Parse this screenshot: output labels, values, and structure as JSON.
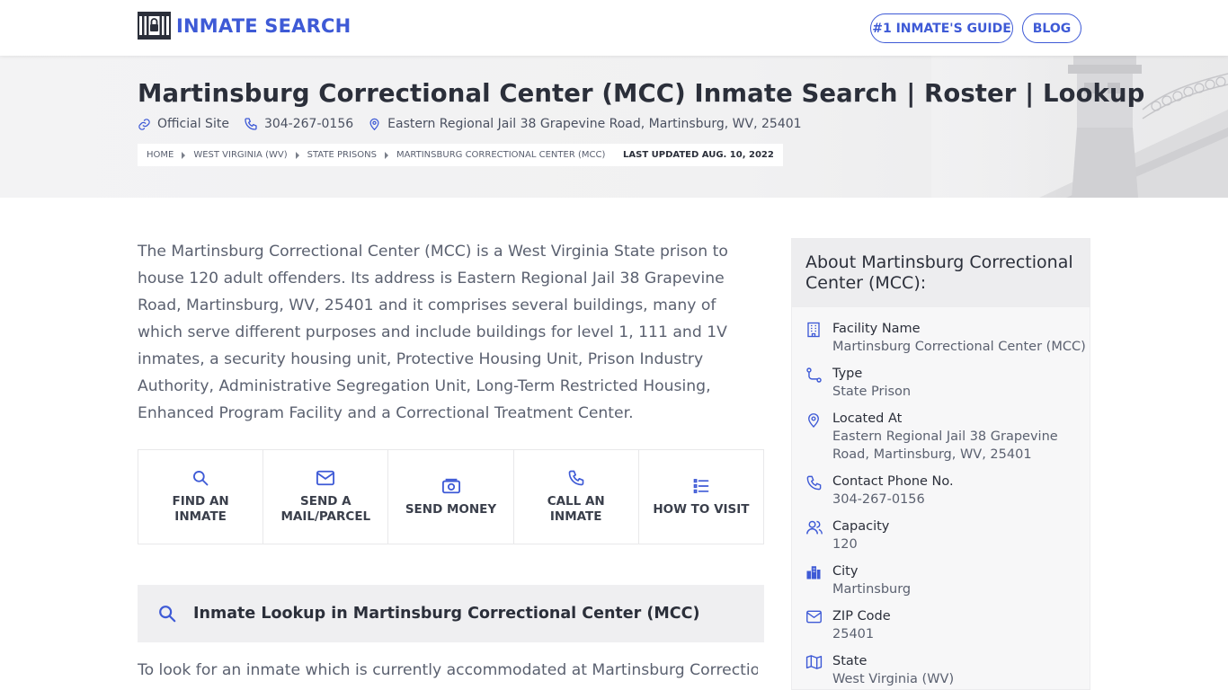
{
  "header": {
    "logo_text": "INMATE SEARCH",
    "nav": {
      "guide_label": "#1 INMATE'S GUIDE",
      "blog_label": "BLOG"
    }
  },
  "hero": {
    "title": "Martinsburg Correctional Center (MCC) Inmate Search | Roster | Lookup",
    "official_site": "Official Site",
    "phone": "304-267-0156",
    "address": "Eastern Regional Jail 38 Grapevine Road, Martinsburg, WV, 25401",
    "breadcrumbs": [
      "HOME",
      "WEST VIRGINIA (WV)",
      "STATE PRISONS",
      "MARTINSBURG CORRECTIONAL CENTER (MCC)"
    ],
    "last_updated": "LAST UPDATED AUG. 10, 2022"
  },
  "main": {
    "intro": "The Martinsburg Correctional Center (MCC) is a West Virginia State prison to house 120 adult offenders. Its address is Eastern Regional Jail 38 Grapevine Road, Martinsburg, WV, 25401 and it comprises several buildings, many of which serve different purposes and include buildings for level 1, 111 and 1V inmates, a security housing unit, Protective Housing Unit, Prison Industry Authority, Administrative Segregation Unit, Long-Term Restricted Housing, Enhanced Program Facility and a Correctional Treatment Center.",
    "actions": [
      {
        "label_line1": "FIND AN",
        "label_line2": "INMATE",
        "icon": "search-icon"
      },
      {
        "label_line1": "SEND A",
        "label_line2": "MAIL/PARCEL",
        "icon": "mail-icon"
      },
      {
        "label_line1": "SEND MONEY",
        "label_line2": "",
        "icon": "money-icon"
      },
      {
        "label_line1": "CALL AN",
        "label_line2": "INMATE",
        "icon": "phone-icon"
      },
      {
        "label_line1": "HOW TO VISIT",
        "label_line2": "",
        "icon": "list-icon"
      }
    ],
    "lookup_title": "Inmate Lookup in Martinsburg Correctional Center (MCC)",
    "bottom_text": "To look for an inmate which is currently accommodated at Martinsburg Correctional"
  },
  "sidebar": {
    "title": "About Martinsburg Correctional Center (MCC):",
    "items": [
      {
        "label": "Facility Name",
        "value": "Martinsburg Correctional Center (MCC)",
        "icon": "building-icon"
      },
      {
        "label": "Type",
        "value": "State Prison",
        "icon": "route-icon"
      },
      {
        "label": "Located At",
        "value": "Eastern Regional Jail 38 Grapevine Road, Martinsburg, WV, 25401",
        "icon": "map-pin-icon"
      },
      {
        "label": "Contact Phone No.",
        "value": "304-267-0156",
        "icon": "phone-icon"
      },
      {
        "label": "Capacity",
        "value": "120",
        "icon": "users-icon"
      },
      {
        "label": "City",
        "value": "Martinsburg",
        "icon": "city-icon"
      },
      {
        "label": "ZIP Code",
        "value": "25401",
        "icon": "mail-icon"
      },
      {
        "label": "State",
        "value": "West Virginia (WV)",
        "icon": "map-icon"
      }
    ]
  },
  "colors": {
    "accent": "#3e5ad6",
    "heading": "#2b2f3a",
    "body_text": "#5b6170"
  }
}
